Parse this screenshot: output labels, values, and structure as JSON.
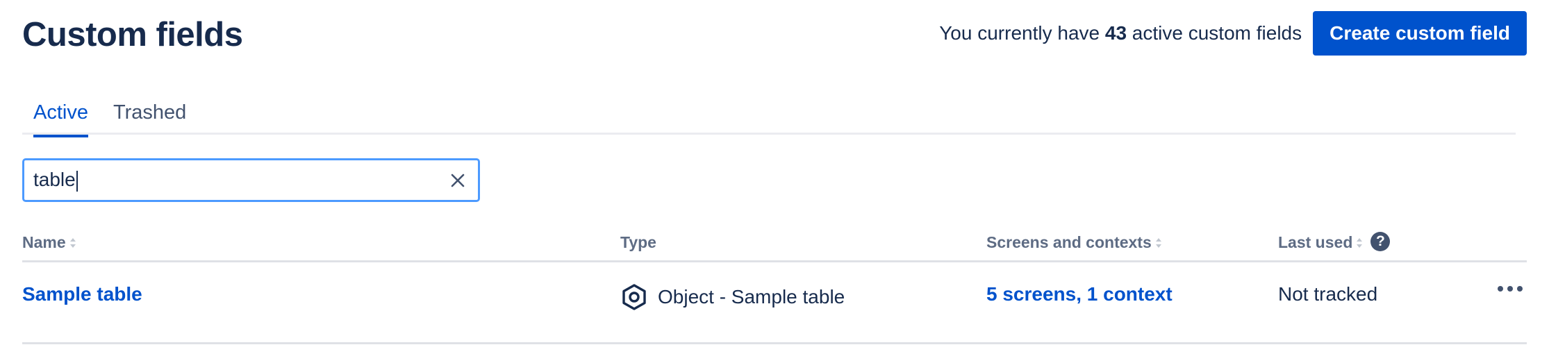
{
  "header": {
    "title": "Custom fields",
    "summary_prefix": "You currently have ",
    "active_count": "43",
    "summary_suffix": " active custom fields",
    "create_button_label": "Create custom field"
  },
  "tabs": [
    {
      "label": "Active",
      "active": true
    },
    {
      "label": "Trashed",
      "active": false
    }
  ],
  "search": {
    "value": "table"
  },
  "table": {
    "columns": {
      "name": "Name",
      "type": "Type",
      "screens": "Screens and contexts",
      "last_used": "Last used"
    },
    "rows": [
      {
        "name": "Sample table",
        "type": "Object - Sample table",
        "screens_contexts": "5 screens, 1 context",
        "last_used": "Not tracked"
      }
    ]
  },
  "colors": {
    "primary": "#0052CC",
    "text": "#172B4D",
    "subtle_text": "#5E6C84",
    "focus_border": "#4C9AFF"
  },
  "icons": {
    "clear": "close-icon",
    "sort": "sort-icon",
    "help": "help-icon",
    "type": "object-hexagon-icon",
    "more": "more-actions-icon"
  }
}
